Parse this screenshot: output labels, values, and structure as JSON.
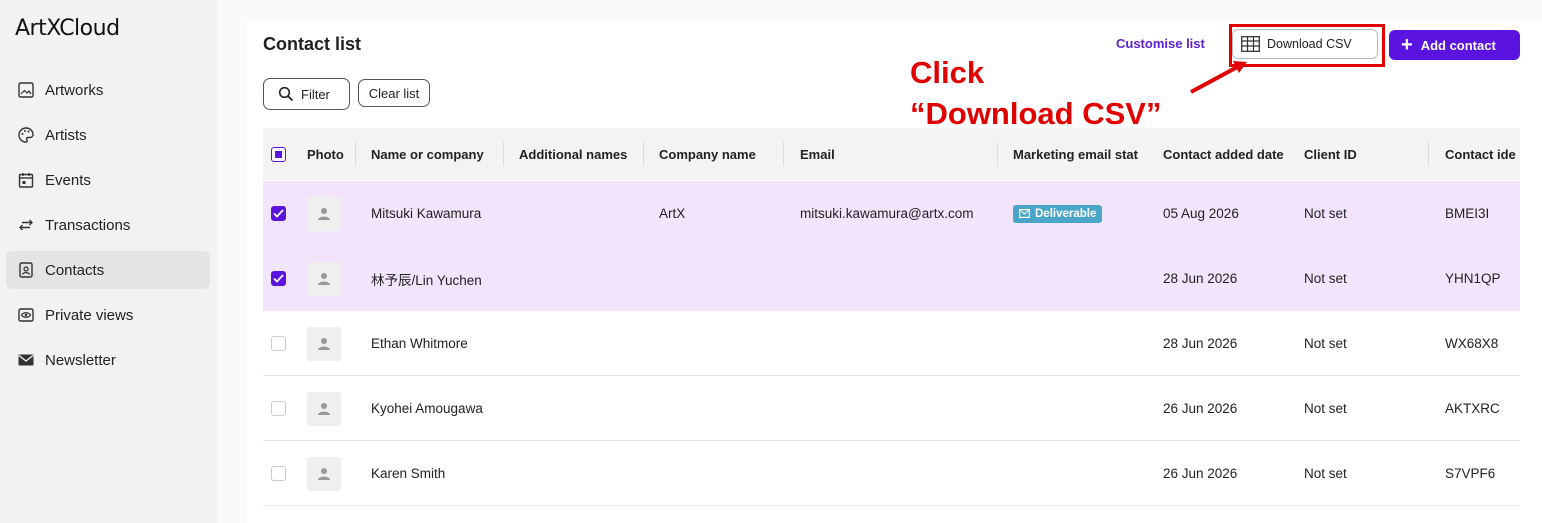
{
  "app": {
    "logo": "ArtXCloud"
  },
  "sidebar": {
    "items": [
      {
        "label": "Artworks",
        "icon": "image-icon"
      },
      {
        "label": "Artists",
        "icon": "palette-icon"
      },
      {
        "label": "Events",
        "icon": "calendar-icon"
      },
      {
        "label": "Transactions",
        "icon": "arrows-icon"
      },
      {
        "label": "Contacts",
        "icon": "contact-card-icon",
        "active": true
      },
      {
        "label": "Private views",
        "icon": "eye-icon"
      },
      {
        "label": "Newsletter",
        "icon": "mail-icon"
      }
    ]
  },
  "header": {
    "title": "Contact list",
    "customise_label": "Customise list",
    "download_label": "Download CSV",
    "add_label": "Add contact"
  },
  "toolbar": {
    "filter_label": "Filter",
    "clear_label": "Clear list"
  },
  "annotation": {
    "line1": "Click",
    "line2": "“Download CSV”",
    "color": "#e00000"
  },
  "table": {
    "columns": [
      "Photo",
      "Name or company",
      "Additional names",
      "Company name",
      "Email",
      "Marketing email stat",
      "Contact added date",
      "Client ID",
      "Contact ide"
    ],
    "rows": [
      {
        "checked": true,
        "name": "Mitsuki Kawamura",
        "additional": "",
        "company": "ArtX",
        "email": "mitsuki.kawamura@artx.com",
        "marketing": "Deliverable",
        "added": "05 Aug 2026",
        "client_id": "Not set",
        "contact_id": "BMEI3I"
      },
      {
        "checked": true,
        "name": "林予辰/Lin Yuchen",
        "additional": "",
        "company": "",
        "email": "",
        "marketing": "",
        "added": "28 Jun 2026",
        "client_id": "Not set",
        "contact_id": "YHN1QP"
      },
      {
        "checked": false,
        "name": "Ethan Whitmore",
        "additional": "",
        "company": "",
        "email": "",
        "marketing": "",
        "added": "28 Jun 2026",
        "client_id": "Not set",
        "contact_id": "WX68X8"
      },
      {
        "checked": false,
        "name": "Kyohei Amougawa",
        "additional": "",
        "company": "",
        "email": "",
        "marketing": "",
        "added": "26 Jun 2026",
        "client_id": "Not set",
        "contact_id": "AKTXRC"
      },
      {
        "checked": false,
        "name": "Karen Smith",
        "additional": "",
        "company": "",
        "email": "",
        "marketing": "",
        "added": "26 Jun 2026",
        "client_id": "Not set",
        "contact_id": "S7VPF6"
      }
    ]
  },
  "colors": {
    "accent": "#5b13e0",
    "selected_row": "#f2e5fb",
    "badge": "#4aa6c8"
  }
}
